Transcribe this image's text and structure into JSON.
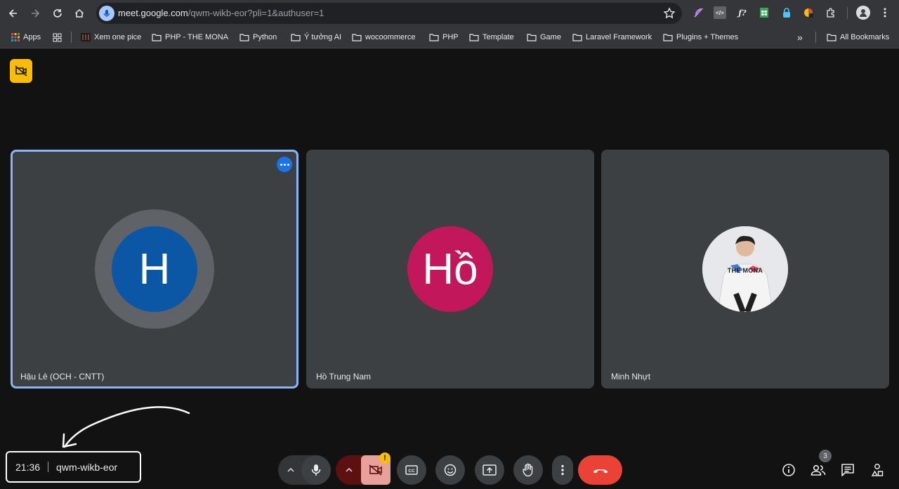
{
  "browser": {
    "url_host": "meet.google.com",
    "url_path": "/qwm-wikb-eor?pli=1&authuser=1",
    "bookmarks": [
      "Apps",
      "Xem one pice",
      "PHP - THE MONA",
      "Python",
      "Ý tưởng AI",
      "wocoommerce",
      "PHP",
      "Template",
      "Game",
      "Laravel Framework",
      "Plugins + Themes"
    ],
    "all_bookmarks": "All Bookmarks"
  },
  "participants": [
    {
      "name": "Hậu Lê (OCH - CNTT)",
      "initial": "H",
      "color": "#0b57a5",
      "speaking": true
    },
    {
      "name": "Hồ Trung Nam",
      "initial": "Hồ",
      "color": "#c2185b",
      "speaking": false
    },
    {
      "name": "Minh Nhựt",
      "initial": "",
      "color": "#ffffff",
      "speaking": false
    }
  ],
  "photo_shirt_text": "THE MONA",
  "meeting": {
    "time": "21:36",
    "code": "qwm-wikb-eor"
  },
  "people_count": "3",
  "colors": {
    "end_call": "#ea4335",
    "camera_off": "#f28b82",
    "camera_off_dark": "#5c1010",
    "warning": "#fbbc04"
  }
}
